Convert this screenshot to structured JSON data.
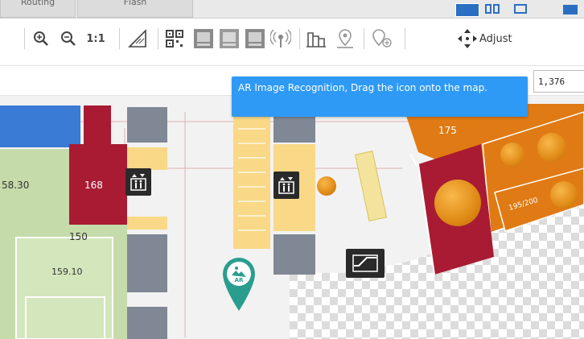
{
  "tabs": [
    {
      "label": "Routing"
    },
    {
      "label": "Flash"
    }
  ],
  "toolbar": {
    "zoom_in": "zoom-in",
    "zoom_out": "zoom-out",
    "actual_size_label": "1:1",
    "adjust_label": "Adjust"
  },
  "coords": {
    "value": "1,376"
  },
  "tooltip": {
    "text": "AR Image Recognition, Drag the icon onto the map."
  },
  "map": {
    "labels": {
      "r58": "58.30",
      "r168": "168",
      "r150": "150",
      "r159": "159.10",
      "r175": "175",
      "r195": "195/200",
      "ar": "AR"
    }
  },
  "colors": {
    "accent": "#2e9af5",
    "crimson": "#a81b33",
    "orange": "#e07a14",
    "green": "#c5dba9",
    "yellow": "#f9d987",
    "teal": "#2a9d8f"
  }
}
